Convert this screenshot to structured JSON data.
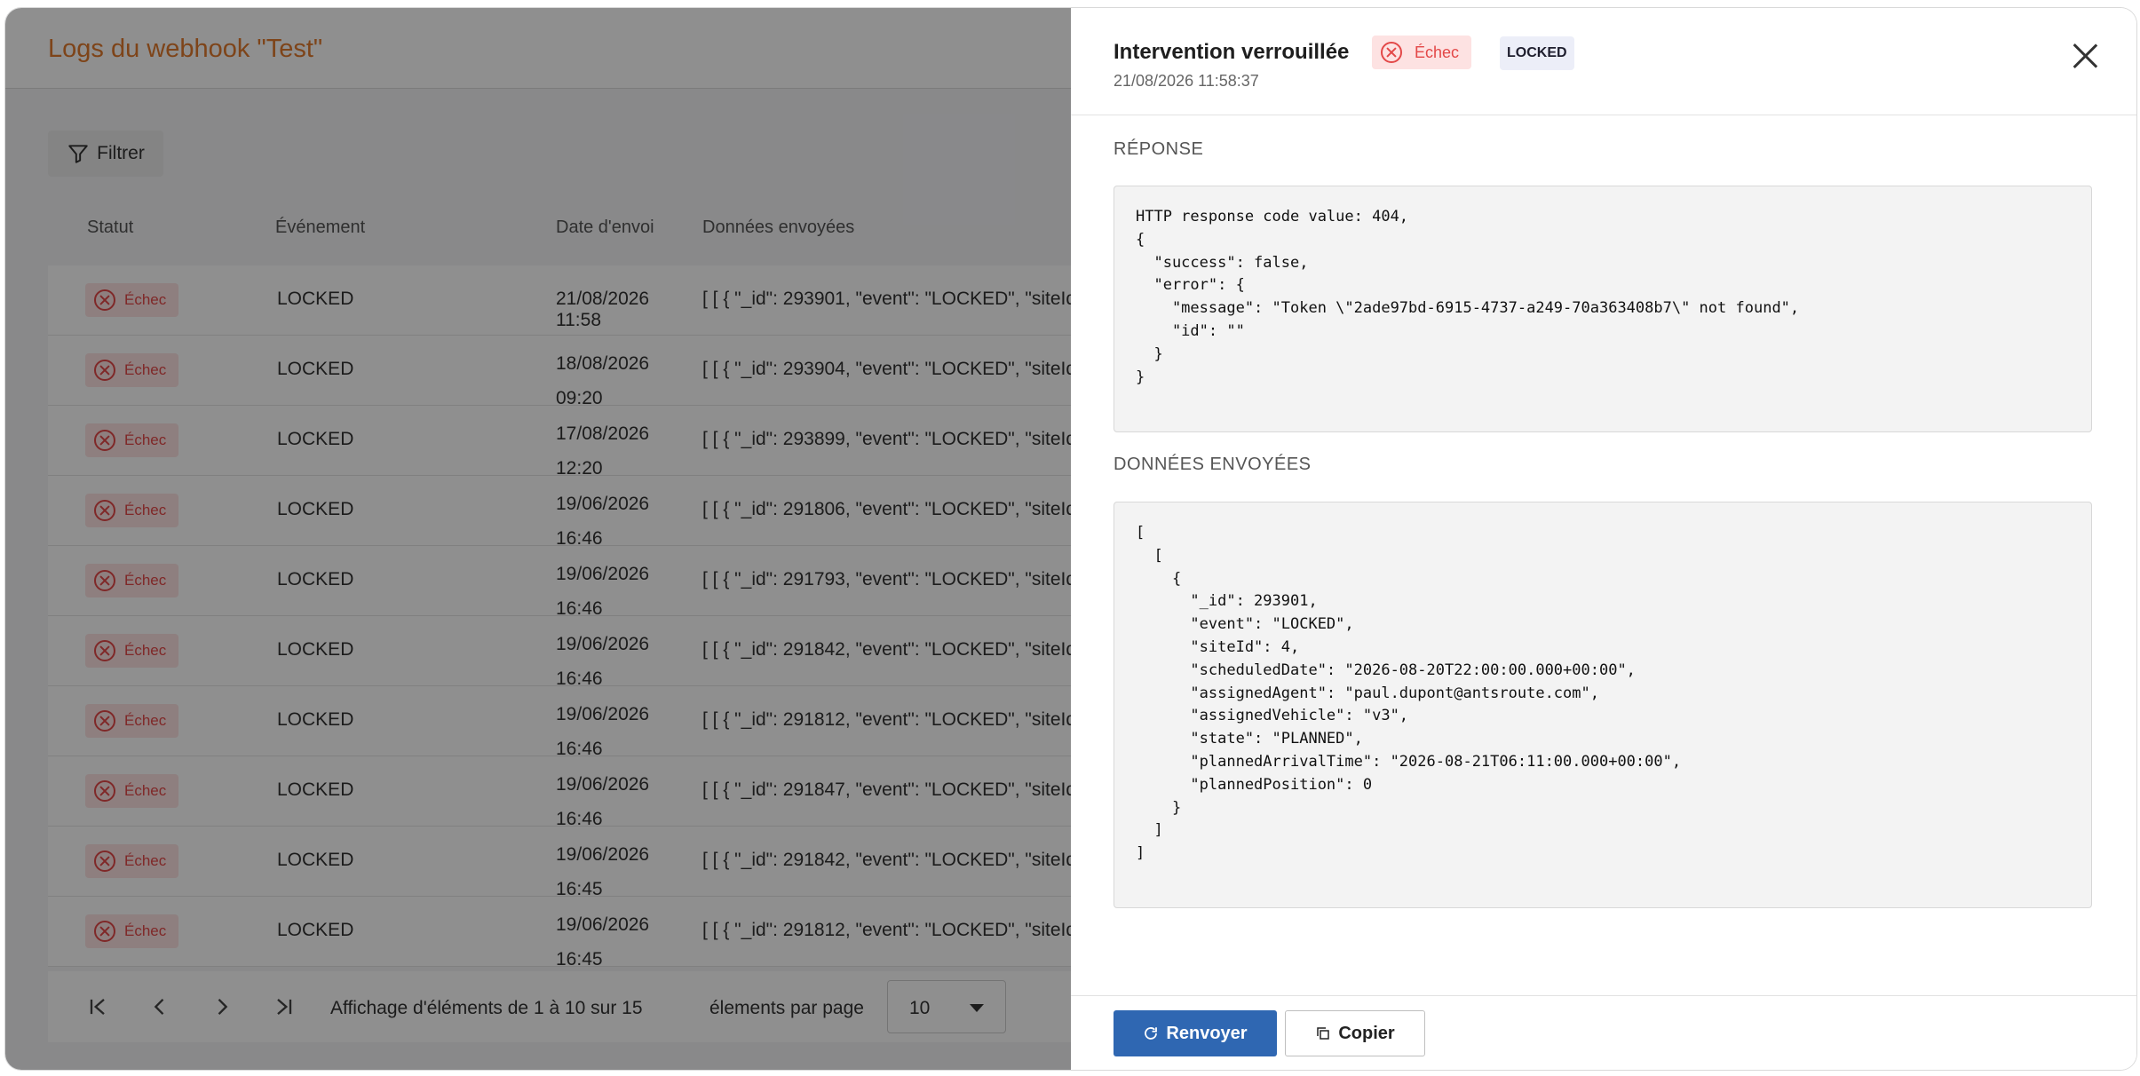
{
  "page": {
    "title": "Logs du webhook \"Test\"",
    "filter_label": "Filtrer",
    "columns": [
      "Statut",
      "Événement",
      "Date d'envoi",
      "Données envoyées"
    ],
    "rows": [
      {
        "status": "Échec",
        "event": "LOCKED",
        "date": "21/08/2026 11:58",
        "data": "[ [ { \"_id\": 293901, \"event\": \"LOCKED\", \"siteId\""
      },
      {
        "status": "Échec",
        "event": "LOCKED",
        "date": "18/08/2026 09:20",
        "data": "[ [ { \"_id\": 293904, \"event\": \"LOCKED\", \"siteId\""
      },
      {
        "status": "Échec",
        "event": "LOCKED",
        "date": "17/08/2026 12:20",
        "data": "[ [ { \"_id\": 293899, \"event\": \"LOCKED\", \"siteId\""
      },
      {
        "status": "Échec",
        "event": "LOCKED",
        "date": "19/06/2026 16:46",
        "data": "[ [ { \"_id\": 291806, \"event\": \"LOCKED\", \"siteId\""
      },
      {
        "status": "Échec",
        "event": "LOCKED",
        "date": "19/06/2026 16:46",
        "data": "[ [ { \"_id\": 291793, \"event\": \"LOCKED\", \"siteId\""
      },
      {
        "status": "Échec",
        "event": "LOCKED",
        "date": "19/06/2026 16:46",
        "data": "[ [ { \"_id\": 291842, \"event\": \"LOCKED\", \"siteId\""
      },
      {
        "status": "Échec",
        "event": "LOCKED",
        "date": "19/06/2026 16:46",
        "data": "[ [ { \"_id\": 291812, \"event\": \"LOCKED\", \"siteId\""
      },
      {
        "status": "Échec",
        "event": "LOCKED",
        "date": "19/06/2026 16:46",
        "data": "[ [ { \"_id\": 291847, \"event\": \"LOCKED\", \"siteId\""
      },
      {
        "status": "Échec",
        "event": "LOCKED",
        "date": "19/06/2026 16:45",
        "data": "[ [ { \"_id\": 291842, \"event\": \"LOCKED\", \"siteId\""
      },
      {
        "status": "Échec",
        "event": "LOCKED",
        "date": "19/06/2026 16:45",
        "data": "[ [ { \"_id\": 291812, \"event\": \"LOCKED\", \"siteId\""
      }
    ],
    "pagination": {
      "first": "|‹",
      "prev": "‹",
      "next": "›",
      "last": "›|",
      "info": "Affichage d'éléments de 1 à 10 sur 15",
      "per_page_label": "élements par page",
      "per_page_value": "10"
    }
  },
  "drawer": {
    "title": "Intervention verrouillée",
    "status": "Échec",
    "event_tag": "LOCKED",
    "date": "21/08/2026 11:58:37",
    "response_label": "RÉPONSE",
    "response_body": "HTTP response code value: 404,\n{\n  \"success\": false,\n  \"error\": {\n    \"message\": \"Token \\\"2ade97bd-6915-4737-a249-70a363408b7\\\" not found\",\n    \"id\": \"\"\n  }\n}",
    "sent_label": "DONNÉES ENVOYÉES",
    "sent_body": "[\n  [\n    {\n      \"_id\": 293901,\n      \"event\": \"LOCKED\",\n      \"siteId\": 4,\n      \"scheduledDate\": \"2026-08-20T22:00:00.000+00:00\",\n      \"assignedAgent\": \"paul.dupont@antsroute.com\",\n      \"assignedVehicle\": \"v3\",\n      \"state\": \"PLANNED\",\n      \"plannedArrivalTime\": \"2026-08-21T06:11:00.000+00:00\",\n      \"plannedPosition\": 0\n    }\n  ]\n]",
    "resend_label": "Renvoyer",
    "copy_label": "Copier"
  },
  "colors": {
    "title_accent": "#e07a2d",
    "fail_red": "#e34848",
    "fail_bg": "#fde2e2",
    "primary_blue": "#2f67b2"
  }
}
